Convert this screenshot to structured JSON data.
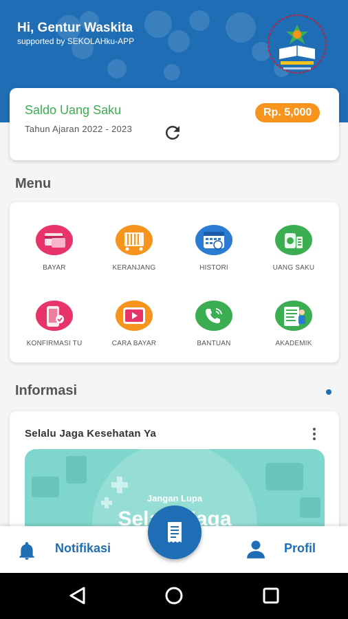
{
  "header": {
    "greeting": "Hi, Gentur Waskita",
    "support": "supported by SEKOLAHku-APP",
    "logo_icon": "school-logo-icon"
  },
  "saldo": {
    "title": "Saldo Uang Saku",
    "year": "Tahun Ajaran 2022 - 2023",
    "amount": "Rp. 5,000",
    "refresh_icon": "refresh-icon"
  },
  "menu": {
    "title": "Menu",
    "items": [
      {
        "label": "BAYAR",
        "icon": "payment-icon",
        "color": "#e8336b"
      },
      {
        "label": "KERANJANG",
        "icon": "cart-icon",
        "color": "#f7941d"
      },
      {
        "label": "HISTORI",
        "icon": "calendar-icon",
        "color": "#2b7bd3"
      },
      {
        "label": "UANG SAKU",
        "icon": "wallet-icon",
        "color": "#3cae52"
      },
      {
        "label": "KONFIRMASI TU",
        "icon": "phone-confirm-icon",
        "color": "#e8336b"
      },
      {
        "label": "CARA BAYAR",
        "icon": "video-icon",
        "color": "#f7941d"
      },
      {
        "label": "BANTUAN",
        "icon": "call-icon",
        "color": "#3cae52"
      },
      {
        "label": "AKADEMIK",
        "icon": "academic-icon",
        "color": "#3cae52"
      }
    ]
  },
  "info": {
    "title": "Informasi",
    "card_title": "Selalu Jaga Kesehatan Ya",
    "banner_sub": "Jangan Lupa",
    "banner_main": "Selalu Jaga"
  },
  "nav": {
    "notif_label": "Notifikasi",
    "profil_label": "Profil"
  },
  "colors": {
    "primary": "#1e6db5",
    "accent_orange": "#f7941d",
    "accent_green": "#3cae52"
  }
}
